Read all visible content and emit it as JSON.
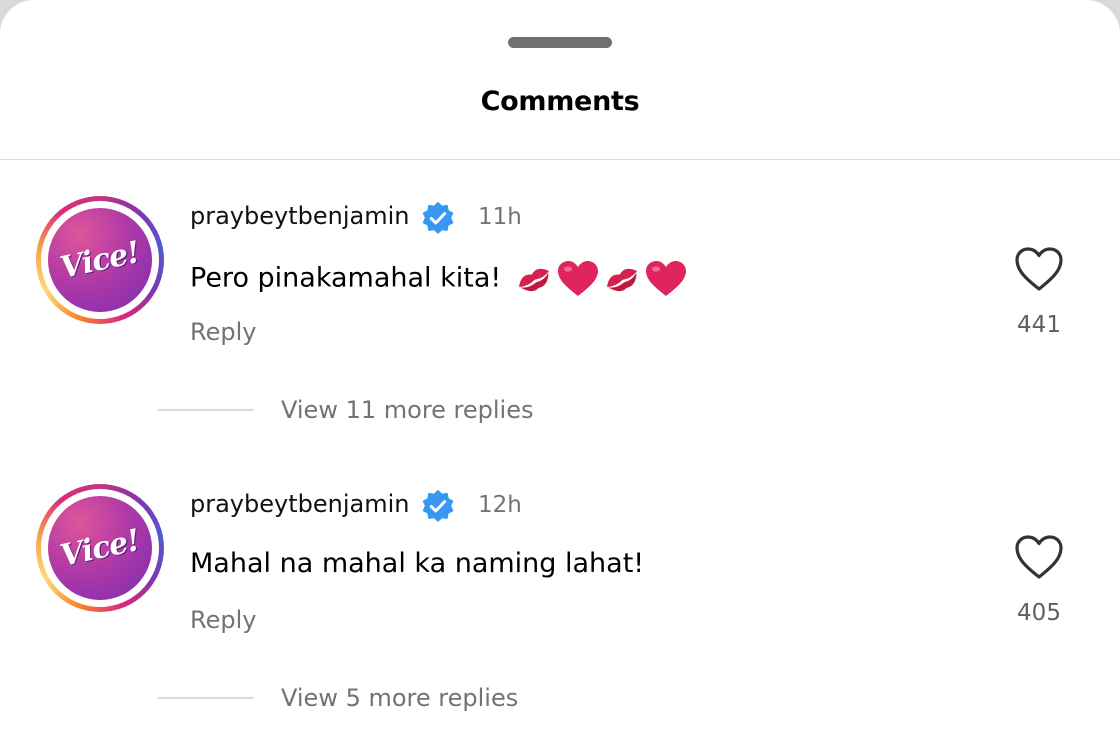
{
  "sheet": {
    "title": "Comments"
  },
  "comments": [
    {
      "username": "praybeytbenjamin",
      "verified": true,
      "time": "11h",
      "text": "Pero pinakamahal kita!",
      "emojis": [
        "kiss-mark",
        "red-heart",
        "kiss-mark",
        "red-heart"
      ],
      "reply_label": "Reply",
      "likes": "441",
      "view_replies": "View 11 more replies",
      "avatar_logo": "Vice!"
    },
    {
      "username": "praybeytbenjamin",
      "verified": true,
      "time": "12h",
      "text": "Mahal na mahal ka naming lahat!",
      "emojis": [],
      "reply_label": "Reply",
      "likes": "405",
      "view_replies": "View 5 more replies",
      "avatar_logo": "Vice!"
    }
  ],
  "colors": {
    "verified_blue": "#3897f0",
    "secondary_text": "#737373",
    "heart_red": "#e0245e",
    "kiss_red": "#d6204e"
  }
}
